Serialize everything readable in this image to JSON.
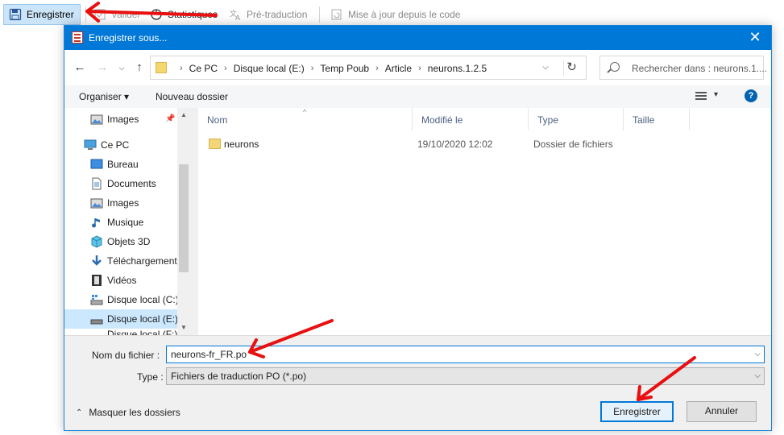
{
  "toolbar": {
    "save_label": "Enregistrer",
    "valider_label": "Valider",
    "stats_label": "Statistiques",
    "pretrad_label": "Pré-traduction",
    "maj_label": "Mise à jour depuis le code"
  },
  "dialog": {
    "title": "Enregistrer sous...",
    "close_label": "✕",
    "breadcrumb": [
      "Ce PC",
      "Disque local (E:)",
      "Temp Poub",
      "Article",
      "neurons.1.2.5"
    ],
    "search_placeholder": "Rechercher dans : neurons.1....",
    "organize_label": "Organiser ▾",
    "new_folder_label": "Nouveau dossier",
    "help_label": "?",
    "sidebar": [
      {
        "label": "Images",
        "icon": "images-icon",
        "pinned": true
      },
      {
        "label": "Ce PC",
        "icon": "pc-icon"
      },
      {
        "label": "Bureau",
        "icon": "desktop-icon"
      },
      {
        "label": "Documents",
        "icon": "documents-icon"
      },
      {
        "label": "Images",
        "icon": "images-icon"
      },
      {
        "label": "Musique",
        "icon": "music-icon"
      },
      {
        "label": "Objets 3D",
        "icon": "cube-icon"
      },
      {
        "label": "Téléchargements",
        "icon": "download-icon"
      },
      {
        "label": "Vidéos",
        "icon": "video-icon"
      },
      {
        "label": "Disque local (C:)",
        "icon": "drive-icon"
      },
      {
        "label": "Disque local (E:)",
        "icon": "drive-icon",
        "selected": true
      },
      {
        "label": "Disque local (F:)",
        "icon": "drive-icon"
      }
    ],
    "columns": [
      "Nom",
      "Modifié le",
      "Type",
      "Taille"
    ],
    "files": [
      {
        "name": "neurons",
        "modified": "19/10/2020 12:02",
        "type": "Dossier de fichiers",
        "size": ""
      }
    ],
    "filename_label": "Nom du fichier :",
    "filename_value": "neurons-fr_FR.po",
    "filetype_label": "Type :",
    "filetype_value": "Fichiers de traduction PO (*.po)",
    "hide_folders_label": "Masquer les dossiers",
    "save_button": "Enregistrer",
    "cancel_button": "Annuler"
  },
  "colors": {
    "accent": "#0078d7",
    "selection": "#cce8ff",
    "annotation_arrow": "#e81010"
  }
}
